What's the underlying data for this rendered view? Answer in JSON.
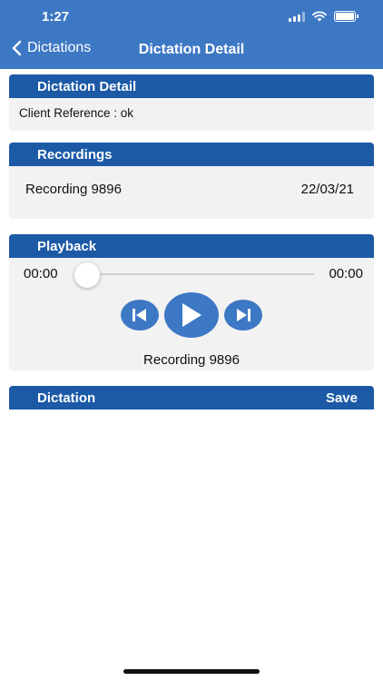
{
  "status": {
    "time": "1:27"
  },
  "nav": {
    "back_label": "Dictations",
    "title": "Dictation Detail"
  },
  "detail": {
    "header": "Dictation Detail",
    "client_reference": "Client Reference : ok"
  },
  "recordings": {
    "header": "Recordings",
    "items": [
      {
        "name": "Recording 9896",
        "date": "22/03/21"
      }
    ]
  },
  "playback": {
    "header": "Playback",
    "elapsed": "00:00",
    "duration": "00:00",
    "progress": 0,
    "current_recording": "Recording 9896"
  },
  "dictation": {
    "header": "Dictation",
    "save_label": "Save"
  },
  "colors": {
    "nav_bg": "#3d78c4",
    "header_bg": "#1c5aa6",
    "control_bg": "#3d78c4",
    "card_bg": "#f2f2f2"
  },
  "icons": [
    "chevron-left-icon",
    "cellular-signal-icon",
    "wifi-icon",
    "battery-icon",
    "skip-previous-icon",
    "play-icon",
    "skip-next-icon"
  ]
}
